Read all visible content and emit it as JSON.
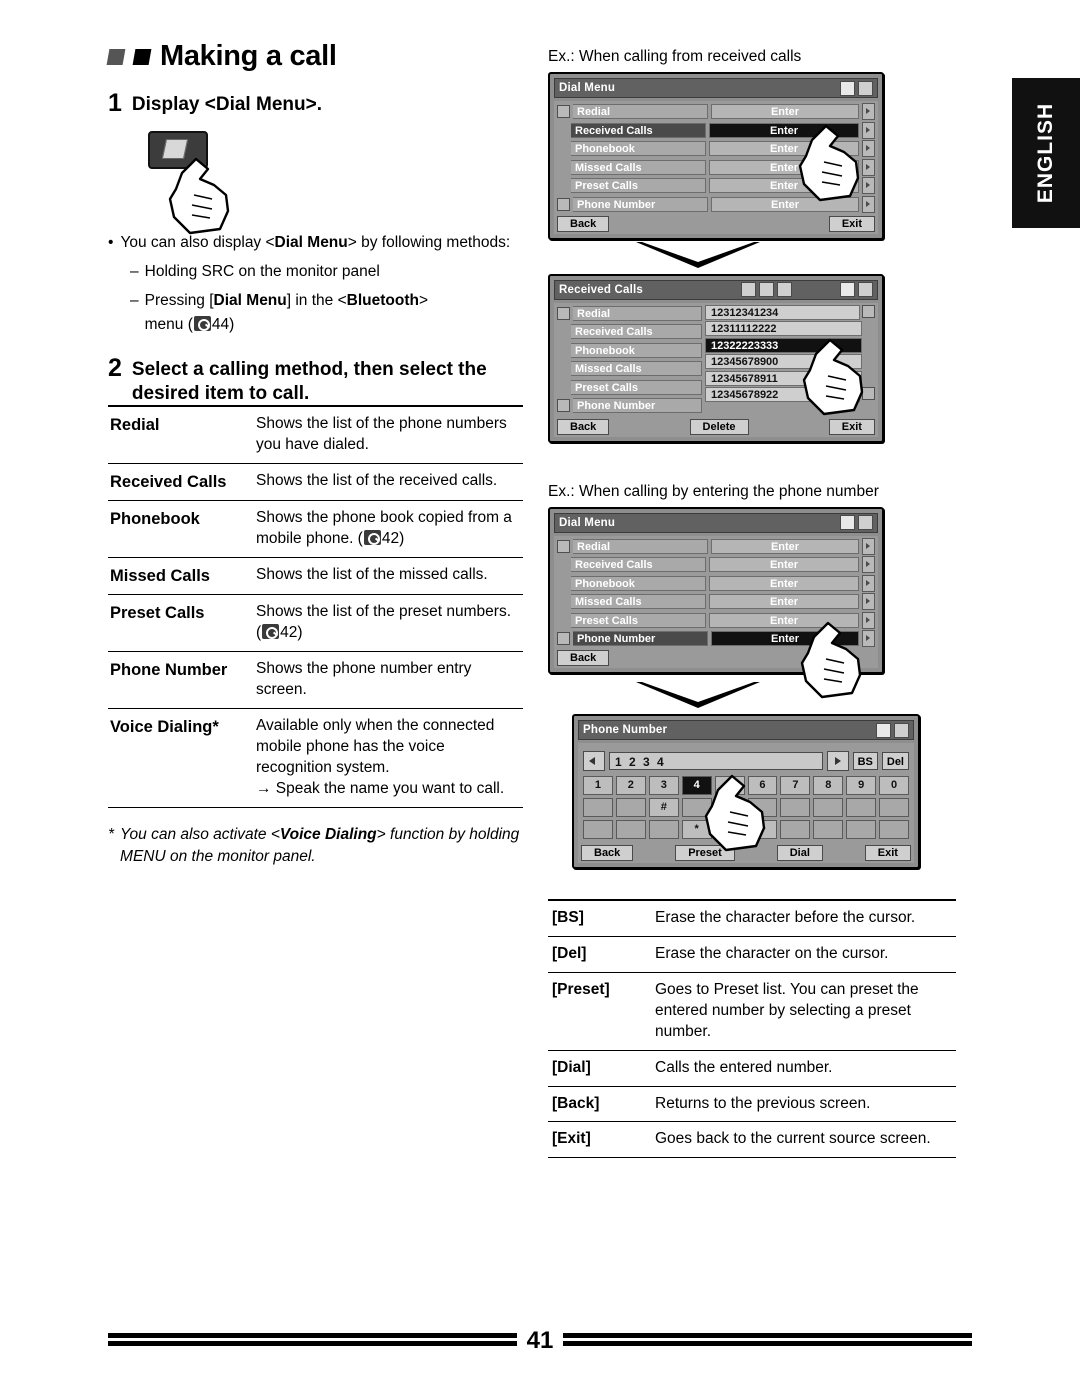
{
  "heading": "Making a call",
  "steps": {
    "one_num": "1",
    "one_text": "Display <Dial Menu>.",
    "two_num": "2",
    "two_text": "Select a calling method, then select the desired item to call."
  },
  "notes": {
    "bullet": "You can also display <Dial Menu> by following methods:",
    "bullet_pre": "You can also display <",
    "bullet_bold": "Dial Menu",
    "bullet_post": "> by following methods:",
    "dash1": "Holding SRC on the monitor panel",
    "dash2_pre": "Pressing [",
    "dash2_b1": "Dial Menu",
    "dash2_mid": "] in the <",
    "dash2_b2": "Bluetooth",
    "dash2_post": ">",
    "dash2_menu": "menu (",
    "dash2_page": "44)"
  },
  "desc_table": [
    {
      "key": "Redial",
      "value": "Shows the list of the phone numbers you have dialed."
    },
    {
      "key": "Received Calls",
      "value": "Shows the list of the received calls."
    },
    {
      "key": "Phonebook",
      "value": "Shows the phone book copied from a mobile phone. (",
      "value2": "42)"
    },
    {
      "key": "Missed Calls",
      "value": "Shows the list of the missed calls."
    },
    {
      "key": "Preset Calls",
      "value": "Shows the list of the preset numbers. (",
      "value2": "42)"
    },
    {
      "key": "Phone Number",
      "value": "Shows the phone number entry screen."
    },
    {
      "key": "Voice Dialing*",
      "value": "Available only when the connected mobile phone has the voice recognition system.",
      "value2": "→ Speak the name you want to call."
    }
  ],
  "footnote": {
    "star": "*",
    "pre": "You can also activate <",
    "bold": "Voice Dialing",
    "post": "> function by holding MENU on the monitor panel."
  },
  "examples": {
    "ex1": "Ex.: When calling from received calls",
    "ex2": "Ex.: When calling by entering the phone number"
  },
  "lcd1": {
    "title": "Dial Menu",
    "items": [
      {
        "label": "Redial",
        "button": "Enter",
        "highlight": false
      },
      {
        "label": "Received Calls",
        "button": "Enter",
        "highlight": true
      },
      {
        "label": "Phonebook",
        "button": "Enter",
        "highlight": false
      },
      {
        "label": "Missed Calls",
        "button": "Enter",
        "highlight": false
      },
      {
        "label": "Preset Calls",
        "button": "Enter",
        "highlight": false
      },
      {
        "label": "Phone Number",
        "button": "Enter",
        "highlight": false
      }
    ],
    "back": "Back",
    "exit": "Exit"
  },
  "lcd2": {
    "title": "Received Calls",
    "items": [
      {
        "label": "Redial"
      },
      {
        "label": "Received Calls"
      },
      {
        "label": "Phonebook"
      },
      {
        "label": "Missed Calls"
      },
      {
        "label": "Preset Calls"
      },
      {
        "label": "Phone Number"
      }
    ],
    "numbers": [
      {
        "value": "12312341234",
        "highlight": false
      },
      {
        "value": "12311112222",
        "highlight": false
      },
      {
        "value": "12322223333",
        "highlight": true
      },
      {
        "value": "12345678900",
        "highlight": false
      },
      {
        "value": "12345678911",
        "highlight": false
      },
      {
        "value": "12345678922",
        "highlight": false
      }
    ],
    "back": "Back",
    "delete": "Delete",
    "exit": "Exit"
  },
  "lcd3": {
    "title": "Dial Menu",
    "items": [
      {
        "label": "Redial",
        "button": "Enter",
        "highlight": false
      },
      {
        "label": "Received Calls",
        "button": "Enter",
        "highlight": false
      },
      {
        "label": "Phonebook",
        "button": "Enter",
        "highlight": false
      },
      {
        "label": "Missed Calls",
        "button": "Enter",
        "highlight": false
      },
      {
        "label": "Preset Calls",
        "button": "Enter",
        "highlight": false
      },
      {
        "label": "Phone Number",
        "button": "Enter",
        "highlight": true
      }
    ],
    "back": "Back"
  },
  "lcd4": {
    "title": "Phone Number",
    "entry_value": "1 2 3 4",
    "bs": "BS",
    "del": "Del",
    "keys_row1": [
      "1",
      "2",
      "3",
      "4",
      "5",
      "6",
      "7",
      "8",
      "9",
      "0"
    ],
    "keys_row1_highlight": 3,
    "keys_row2": [
      "",
      "",
      "#",
      "",
      "",
      "",
      "",
      "",
      "",
      ""
    ],
    "keys_row3": [
      "",
      "",
      "",
      "*",
      "",
      "+",
      "",
      "",
      "",
      ""
    ],
    "back": "Back",
    "preset": "Preset",
    "dial": "Dial",
    "exit": "Exit"
  },
  "key_table": [
    {
      "key": "[BS]",
      "value": "Erase the character before the cursor."
    },
    {
      "key": "[Del]",
      "value": "Erase the character on the cursor."
    },
    {
      "key": "[Preset]",
      "value": "Goes to Preset list. You can preset the entered number by selecting a preset number."
    },
    {
      "key": "[Dial]",
      "value": "Calls the entered number."
    },
    {
      "key": "[Back]",
      "value": "Returns to the previous screen."
    },
    {
      "key": "[Exit]",
      "value": "Goes back to the current source screen."
    }
  ],
  "english_tab": "ENGLISH",
  "page_number": "41"
}
